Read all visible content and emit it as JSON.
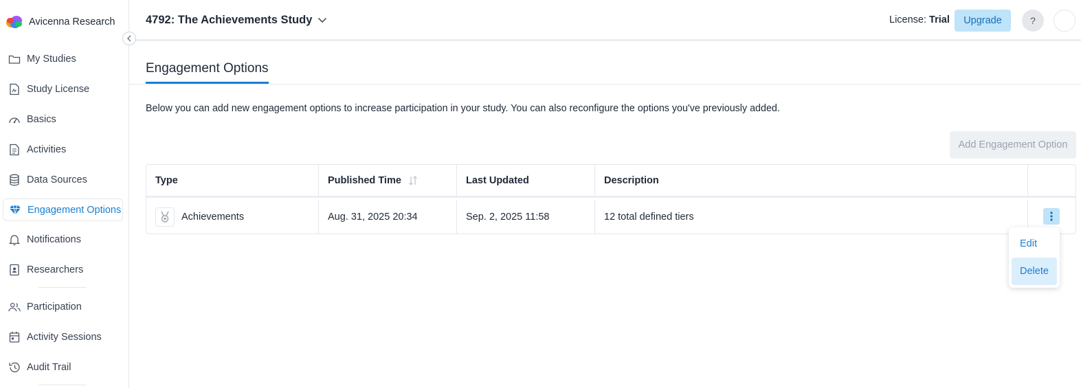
{
  "brand": {
    "name": "Avicenna Research"
  },
  "sidebar": {
    "items": [
      {
        "label": "My Studies",
        "icon": "folder-icon"
      },
      {
        "label": "Study License",
        "icon": "license-icon"
      },
      {
        "label": "Basics",
        "icon": "gauge-icon"
      },
      {
        "label": "Activities",
        "icon": "document-icon"
      },
      {
        "label": "Data Sources",
        "icon": "database-icon"
      },
      {
        "label": "Engagement Options",
        "icon": "diamond-icon",
        "active": true
      },
      {
        "label": "Notifications",
        "icon": "bell-icon"
      },
      {
        "label": "Researchers",
        "icon": "badge-icon"
      },
      {
        "label": "Participation",
        "icon": "users-icon"
      },
      {
        "label": "Activity Sessions",
        "icon": "calendar-icon"
      },
      {
        "label": "Audit Trail",
        "icon": "history-icon"
      }
    ]
  },
  "header": {
    "study_title": "4792: The Achievements Study",
    "license_label": "License:",
    "license_value": "Trial",
    "upgrade_label": "Upgrade",
    "help_label": "?"
  },
  "main": {
    "tab_label": "Engagement Options",
    "intro": "Below you can add new engagement options to increase participation in your study. You can also reconfigure the options you've previously added.",
    "add_button": "Add Engagement Option",
    "table": {
      "columns": [
        "Type",
        "Published Time",
        "Last Updated",
        "Description"
      ],
      "rows": [
        {
          "type": "Achievements",
          "published": "Aug. 31, 2025 20:34",
          "updated": "Sep. 2, 2025 11:58",
          "description": "12 total defined tiers"
        }
      ]
    },
    "row_menu": {
      "items": [
        "Edit",
        "Delete"
      ]
    }
  },
  "colors": {
    "accent": "#1a7fd4",
    "upgrade_bg": "#bfe3f8",
    "menu_highlight": "#dbeefc"
  }
}
